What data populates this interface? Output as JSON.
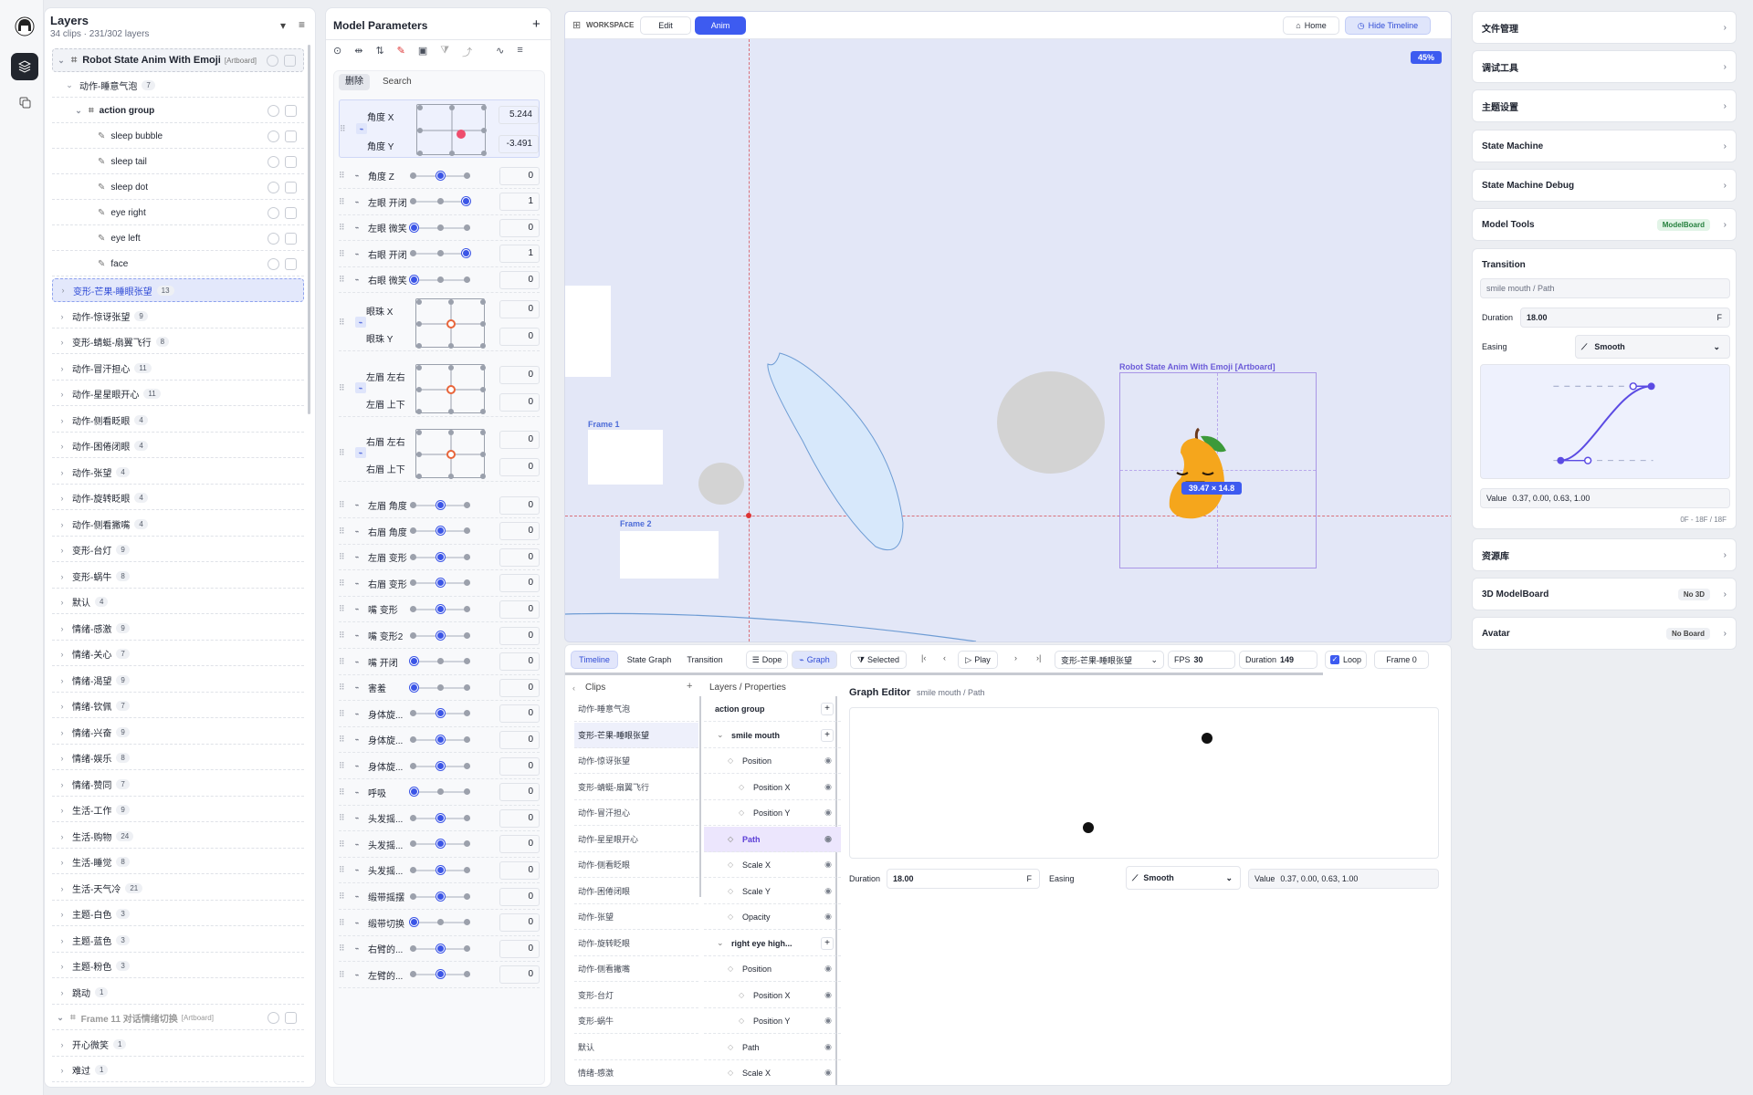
{
  "rail": {
    "items": [
      "avatar",
      "layers",
      "pages"
    ]
  },
  "layers": {
    "title": "Layers",
    "subtitle": "34 clips · 231/302 layers",
    "artboard": {
      "name": "Robot State Anim With Emoji",
      "tag": "[Artboard]"
    },
    "group": {
      "name": "动作-睡意气泡",
      "count": "7"
    },
    "action_group": "action group",
    "children": [
      "sleep bubble",
      "sleep tail",
      "sleep dot",
      "eye right",
      "eye left",
      "face"
    ],
    "selected": {
      "name": "变形-芒果-睡眼张望",
      "count": "13"
    },
    "items": [
      {
        "name": "动作-惊讶张望",
        "count": "9"
      },
      {
        "name": "变形-蜻蜓-扇翼飞行",
        "count": "8"
      },
      {
        "name": "动作-冒汗担心",
        "count": "11"
      },
      {
        "name": "动作-星星眼开心",
        "count": "11"
      },
      {
        "name": "动作-侧看眨眼",
        "count": "4"
      },
      {
        "name": "动作-困倦闭眼",
        "count": "4"
      },
      {
        "name": "动作-张望",
        "count": "4"
      },
      {
        "name": "动作-旋转眨眼",
        "count": "4"
      },
      {
        "name": "动作-侧看撇嘴",
        "count": "4"
      },
      {
        "name": "变形-台灯",
        "count": "9"
      },
      {
        "name": "变形-蜗牛",
        "count": "8"
      },
      {
        "name": "默认",
        "count": "4"
      },
      {
        "name": "情绪-感激",
        "count": "9"
      },
      {
        "name": "情绪-关心",
        "count": "7"
      },
      {
        "name": "情绪-渴望",
        "count": "9"
      },
      {
        "name": "情绪-钦佩",
        "count": "7"
      },
      {
        "name": "情绪-兴奋",
        "count": "9"
      },
      {
        "name": "情绪-娱乐",
        "count": "8"
      },
      {
        "name": "情绪-赞同",
        "count": "7"
      },
      {
        "name": "生活-工作",
        "count": "9"
      },
      {
        "name": "生活-购物",
        "count": "24"
      },
      {
        "name": "生活-睡觉",
        "count": "8"
      },
      {
        "name": "生活-天气冷",
        "count": "21"
      },
      {
        "name": "主题-白色",
        "count": "3"
      },
      {
        "name": "主题-蓝色",
        "count": "3"
      },
      {
        "name": "主题-粉色",
        "count": "3"
      },
      {
        "name": "跳动",
        "count": "1"
      }
    ],
    "artboard2": {
      "name": "Frame 11 对话情绪切换",
      "tag": "[Artboard]"
    },
    "items2": [
      {
        "name": "开心微笑",
        "count": "1"
      },
      {
        "name": "难过",
        "count": "1"
      }
    ]
  },
  "params": {
    "title": "Model Parameters",
    "tab_delete": "删除",
    "tab_search": "Search",
    "pads": [
      {
        "a": "角度 X",
        "b": "角度 Y",
        "va": "5.244",
        "vb": "-3.491"
      },
      {
        "a": "眼珠 X",
        "b": "眼珠 Y",
        "va": "0",
        "vb": "0"
      },
      {
        "a": "左眉 左右",
        "b": "左眉 上下",
        "va": "0",
        "vb": "0"
      },
      {
        "a": "右眉 左右",
        "b": "右眉 上下",
        "va": "0",
        "vb": "0"
      }
    ],
    "rows_a": [
      {
        "label": "角度 Z",
        "value": "0",
        "pos": 0.5
      },
      {
        "label": "左眼 开闭",
        "value": "1",
        "pos": 1
      },
      {
        "label": "左眼 微笑",
        "value": "0",
        "pos": 0
      },
      {
        "label": "右眼 开闭",
        "value": "1",
        "pos": 1
      },
      {
        "label": "右眼 微笑",
        "value": "0",
        "pos": 0
      }
    ],
    "rows_b": [
      {
        "label": "左眉 角度",
        "value": "0",
        "pos": 0.5
      },
      {
        "label": "右眉 角度",
        "value": "0",
        "pos": 0.5
      },
      {
        "label": "左眉 变形",
        "value": "0",
        "pos": 0.5
      },
      {
        "label": "右眉 变形",
        "value": "0",
        "pos": 0.5
      },
      {
        "label": "嘴 变形",
        "value": "0",
        "pos": 0.5
      },
      {
        "label": "嘴 变形2",
        "value": "0",
        "pos": 0.5
      },
      {
        "label": "嘴 开闭",
        "value": "0",
        "pos": 0
      },
      {
        "label": "害羞",
        "value": "0",
        "pos": 0
      },
      {
        "label": "身体旋...",
        "value": "0",
        "pos": 0.5
      },
      {
        "label": "身体旋...",
        "value": "0",
        "pos": 0.5
      },
      {
        "label": "身体旋...",
        "value": "0",
        "pos": 0.5
      },
      {
        "label": "呼吸",
        "value": "0",
        "pos": 0
      },
      {
        "label": "头发摇...",
        "value": "0",
        "pos": 0.5
      },
      {
        "label": "头发摇...",
        "value": "0",
        "pos": 0.5
      },
      {
        "label": "头发摇...",
        "value": "0",
        "pos": 0.5
      },
      {
        "label": "缎带摇摆",
        "value": "0",
        "pos": 0.5
      },
      {
        "label": "缎带切换",
        "value": "0",
        "pos": 0
      },
      {
        "label": "右臂的...",
        "value": "0",
        "pos": 0.5
      },
      {
        "label": "左臂的...",
        "value": "0",
        "pos": 0.5
      }
    ]
  },
  "canvas": {
    "workspace": "WORKSPACE",
    "edit": "Edit",
    "anim": "Anim",
    "home": "Home",
    "hide_timeline": "Hide Timeline",
    "zoom": "45%",
    "frame1": "Frame 1",
    "frame2": "Frame 2",
    "artboard_label": "Robot State Anim With Emoji [Artboard]",
    "size_label": "39.47 × 14.8"
  },
  "timeline": {
    "tabs": [
      "Timeline",
      "State Graph",
      "Transition"
    ],
    "dope": "Dope",
    "graph": "Graph",
    "selected": "Selected",
    "play": "Play",
    "clip_select": "变形-芒果-睡眼张望",
    "fps_label": "FPS",
    "fps": "30",
    "duration_label": "Duration",
    "duration": "149",
    "loop": "Loop",
    "frame": "Frame 0",
    "clips_title": "Clips",
    "layers_title": "Layers / Properties",
    "clips": [
      "动作-睡意气泡",
      "变形-芒果-睡眼张望",
      "动作-惊讶张望",
      "变形-蜻蜓-扇翼飞行",
      "动作-冒汗担心",
      "动作-星星眼开心",
      "动作-侧看眨眼",
      "动作-困倦闭眼",
      "动作-张望",
      "动作-旋转眨眼",
      "动作-侧看撇嘴",
      "变形-台灯",
      "变形-蜗牛",
      "默认",
      "情绪-感激"
    ],
    "props": [
      {
        "t": "action group",
        "lvl": 0,
        "bold": true
      },
      {
        "t": "smile mouth",
        "lvl": 1,
        "bold": true
      },
      {
        "t": "Position",
        "lvl": 2
      },
      {
        "t": "Position X",
        "lvl": 3
      },
      {
        "t": "Position Y",
        "lvl": 3
      },
      {
        "t": "Path",
        "lvl": 2,
        "sel": true
      },
      {
        "t": "Scale X",
        "lvl": 2
      },
      {
        "t": "Scale Y",
        "lvl": 2
      },
      {
        "t": "Opacity",
        "lvl": 2
      },
      {
        "t": "right eye high...",
        "lvl": 1,
        "bold": true
      },
      {
        "t": "Position",
        "lvl": 2
      },
      {
        "t": "Position X",
        "lvl": 3
      },
      {
        "t": "Position Y",
        "lvl": 3
      },
      {
        "t": "Path",
        "lvl": 2
      },
      {
        "t": "Scale X",
        "lvl": 2
      }
    ],
    "graph_title": "Graph Editor",
    "graph_sub": "smile mouth / Path",
    "g_duration_label": "Duration",
    "g_duration": "18.00",
    "g_unit": "F",
    "g_easing_label": "Easing",
    "g_easing": "Smooth",
    "g_value_label": "Value",
    "g_value": "0.37, 0.00, 0.63, 1.00"
  },
  "right": {
    "cards": [
      "文件管理",
      "调试工具",
      "主题设置",
      "State Machine",
      "State Machine Debug"
    ],
    "model_tools": "Model Tools",
    "model_badge": "ModelBoard",
    "transition": {
      "title": "Transition",
      "path": "smile mouth / Path",
      "duration_label": "Duration",
      "duration": "18.00",
      "unit": "F",
      "easing_label": "Easing",
      "easing": "Smooth",
      "value_label": "Value",
      "value": "0.37, 0.00, 0.63, 1.00",
      "range": "0F - 18F / 18F"
    },
    "res": "资源库",
    "mb3d": "3D ModelBoard",
    "mb3d_badge": "No 3D",
    "avatar": "Avatar",
    "avatar_badge": "No Board"
  }
}
